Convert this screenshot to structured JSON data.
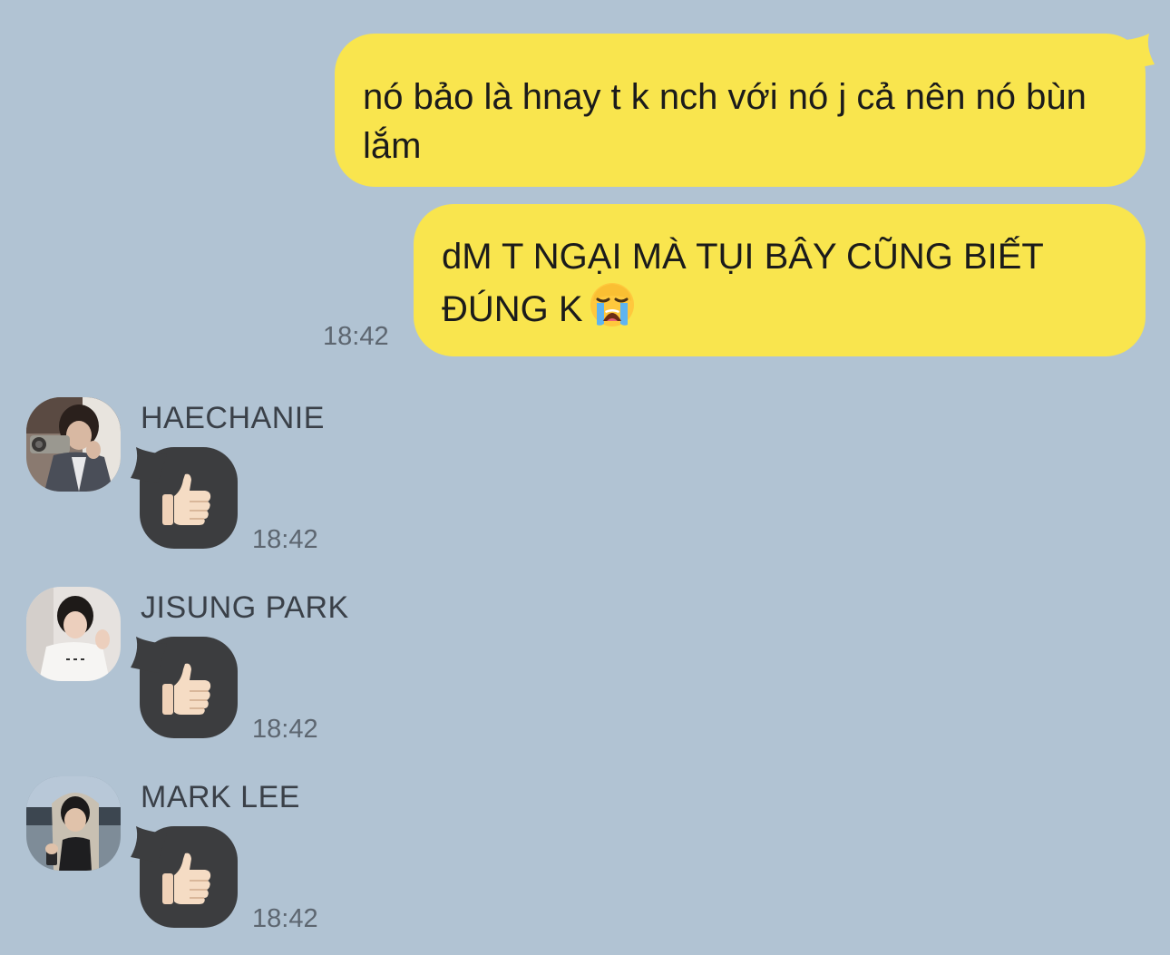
{
  "outgoing": [
    {
      "text": "nó bảo là hnay t k nch với nó j cả nên nó bùn lắm"
    },
    {
      "text": "dM T NGẠI MÀ TỤI BÂY CŨNG BIẾT ĐÚNG K",
      "emoji": "loudly-crying-face-icon",
      "time": "18:42"
    }
  ],
  "incoming": [
    {
      "sender": "HAECHANIE",
      "emoji": "thumbs-up-icon",
      "time": "18:42"
    },
    {
      "sender": "JISUNG PARK",
      "emoji": "thumbs-up-icon",
      "time": "18:42"
    },
    {
      "sender": "MARK LEE",
      "emoji": "thumbs-up-icon",
      "time": "18:42"
    }
  ],
  "colors": {
    "background": "#b1c3d3",
    "outgoing_bubble": "#f9e54e",
    "incoming_bubble": "#3c3d3f",
    "timestamp": "#5d6670"
  }
}
